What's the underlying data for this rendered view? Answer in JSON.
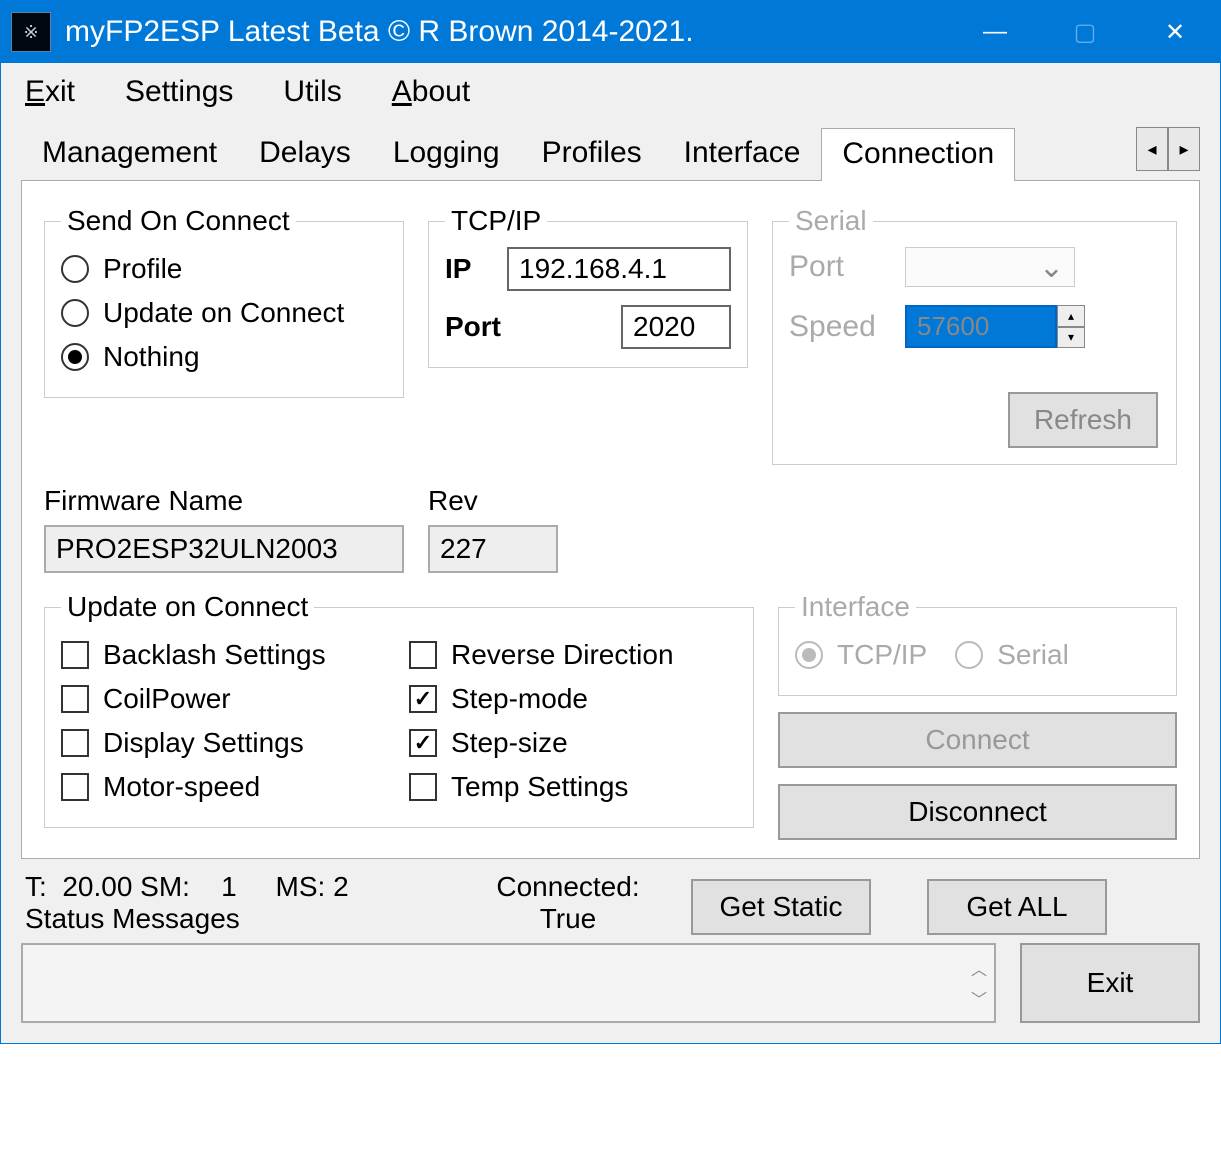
{
  "title": "myFP2ESP Latest Beta © R Brown 2014-2021.",
  "menu": {
    "exit": "Exit",
    "settings": "Settings",
    "utils": "Utils",
    "about": "About"
  },
  "tabs": {
    "management": "Management",
    "delays": "Delays",
    "logging": "Logging",
    "profiles": "Profiles",
    "interface": "Interface",
    "connection": "Connection"
  },
  "sendOnConnect": {
    "legend": "Send On Connect",
    "profile": "Profile",
    "update": "Update on Connect",
    "nothing": "Nothing"
  },
  "tcpip": {
    "legend": "TCP/IP",
    "ipLabel": "IP",
    "ip": "192.168.4.1",
    "portLabel": "Port",
    "port": "2020"
  },
  "serial": {
    "legend": "Serial",
    "portLabel": "Port",
    "speedLabel": "Speed",
    "speed": "57600",
    "refresh": "Refresh"
  },
  "firmware": {
    "nameLabel": "Firmware Name",
    "name": "PRO2ESP32ULN2003",
    "revLabel": "Rev",
    "rev": "227"
  },
  "updateOnConnect": {
    "legend": "Update on Connect",
    "backlash": "Backlash Settings",
    "coilpower": "CoilPower",
    "display": "Display Settings",
    "motorspeed": "Motor-speed",
    "reverse": "Reverse Direction",
    "stepmode": "Step-mode",
    "stepsize": "Step-size",
    "temp": "Temp Settings"
  },
  "interface": {
    "legend": "Interface",
    "tcpip": "TCP/IP",
    "serial": "Serial"
  },
  "buttons": {
    "connect": "Connect",
    "disconnect": "Disconnect",
    "getStatic": "Get Static",
    "getAll": "Get ALL",
    "exit": "Exit"
  },
  "status": {
    "line1": "T:  20.00 SM:    1     MS: 2",
    "connectedLabel": "Connected:",
    "connectedVal": "True",
    "msgLabel": "Status Messages"
  }
}
